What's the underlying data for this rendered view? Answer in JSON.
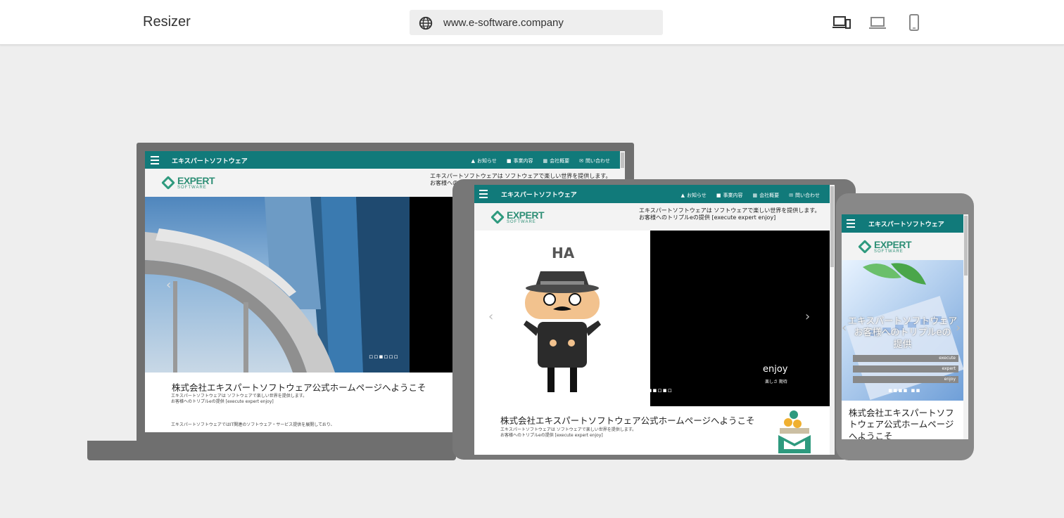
{
  "app": {
    "title": "Resizer"
  },
  "url": {
    "value": "www.e-software.company"
  },
  "devices": [
    "responsive",
    "laptop",
    "phone"
  ],
  "site": {
    "nav_title": "エキスパートソフトウェア",
    "menu": [
      "お知らせ",
      "事業内容",
      "会社概要",
      "問い合わせ"
    ],
    "logo_big": "EXPERT",
    "logo_small": "SOFTWARE",
    "tagline_1": "エキスパートソフトウェアは ソフトウェアで楽しい世界を提供します。",
    "tagline_2": "お客様へのトリプルeの提供 [execute expert enjoy]",
    "welcome": "株式会社エキスパートソフトウェア公式ホームページへようこそ",
    "body_1": "エキスパートソフトウェアは ソフトウェアで楽しい世界を提供します。",
    "body_2": "お客様へのトリプルeの提供 [execute expert enjoy]",
    "body_3": "エキスパートソフトウェアではIT関連のソフトウェア・サービス提供を展開しており、",
    "tablet_ha": "HA",
    "tablet_enjoy": "enjoy",
    "tablet_enjoy_sub": "楽しさ 期待",
    "phone_overlay_1": "エキスパートソフトウェア",
    "phone_overlay_2": "お客様へのトリプルeの",
    "phone_overlay_3": "提供",
    "phone_bar_1": "execute",
    "phone_bar_2": "expert",
    "phone_bar_3": "enjoy",
    "phone_welcome": "株式会社エキスパートソフトウェア公式ホームページへようこそ"
  },
  "colors": {
    "nav": "#117a7a",
    "frame": "#6f6f6f",
    "accent": "#2e8f76"
  }
}
